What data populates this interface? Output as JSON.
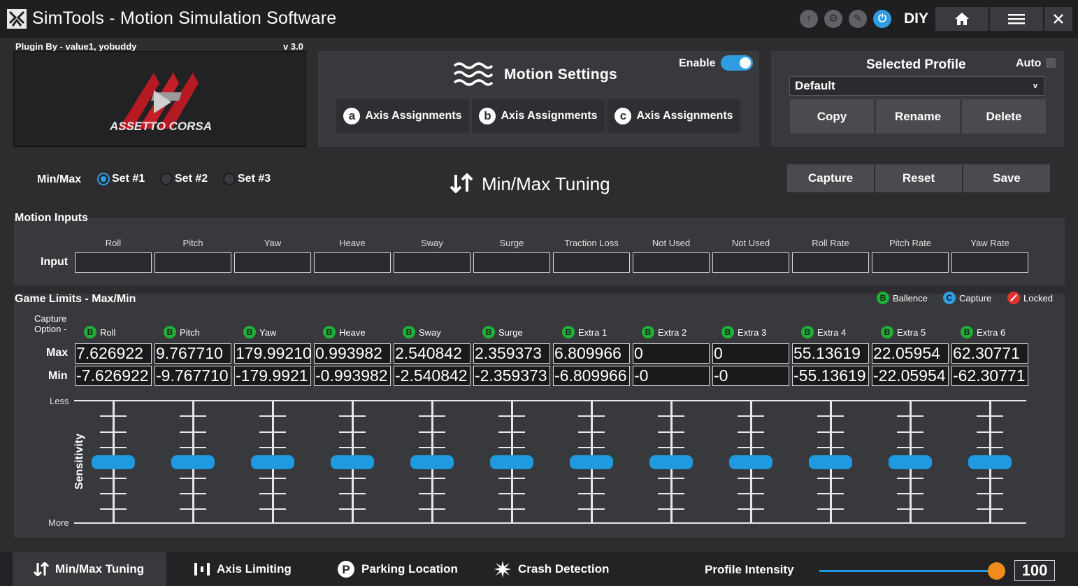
{
  "app": {
    "title": "SimTools - Motion Simulation Software",
    "diy_label": "DIY",
    "accent_color": "#2f9de2"
  },
  "titlebar_icons": [
    "arrow-up-icon",
    "gear-icon",
    "edit-icon",
    "power-icon",
    "home-icon",
    "menu-icon",
    "close-icon"
  ],
  "plugin": {
    "label": "Plugin By - value1, yobuddy",
    "version": "v 3.0",
    "game_logo_text": "ASSETTO CORSA"
  },
  "motion_settings": {
    "title": "Motion Settings",
    "enable_label": "Enable",
    "enabled": true,
    "axis_buttons": [
      {
        "badge": "a",
        "label": "Axis Assignments"
      },
      {
        "badge": "b",
        "label": "Axis Assignments"
      },
      {
        "badge": "c",
        "label": "Axis Assignments"
      }
    ]
  },
  "profile": {
    "title": "Selected Profile",
    "auto_label": "Auto",
    "auto_checked": false,
    "selected": "Default",
    "dropdown_chevron": "v",
    "copy_label": "Copy",
    "rename_label": "Rename",
    "delete_label": "Delete"
  },
  "tuning": {
    "minmax_label": "Min/Max",
    "sets": [
      "Set #1",
      "Set #2",
      "Set #3"
    ],
    "selected_set": 0,
    "title": "Min/Max Tuning",
    "capture_label": "Capture",
    "reset_label": "Reset",
    "save_label": "Save"
  },
  "motion_inputs": {
    "title": "Motion Inputs",
    "row_label": "Input",
    "columns": [
      "Roll",
      "Pitch",
      "Yaw",
      "Heave",
      "Sway",
      "Surge",
      "Traction Loss",
      "Not Used",
      "Not Used",
      "Roll Rate",
      "Pitch Rate",
      "Yaw Rate"
    ],
    "values": [
      "",
      "",
      "",
      "",
      "",
      "",
      "",
      "",
      "",
      "",
      "",
      ""
    ]
  },
  "game_limits": {
    "title": "Game Limits - Max/Min",
    "legend": [
      {
        "badge": "B",
        "label": "Ballence",
        "color": "#1fb037"
      },
      {
        "badge": "C",
        "label": "Capture",
        "color": "#2f9de2"
      },
      {
        "badge": "",
        "label": "Locked",
        "color": "#e23333"
      }
    ],
    "capture_option_label": "Capture Option -",
    "max_label": "Max",
    "min_label": "Min",
    "columns": [
      "Roll",
      "Pitch",
      "Yaw",
      "Heave",
      "Sway",
      "Surge",
      "Extra 1",
      "Extra 2",
      "Extra 3",
      "Extra 4",
      "Extra 5",
      "Extra 6"
    ],
    "column_badge": "B",
    "max_values": [
      "7.626922",
      "9.767710",
      "179.99210",
      "0.993982",
      "2.540842",
      "2.359373",
      "6.809966",
      "0",
      "0",
      "55.13619",
      "22.05954",
      "62.30771"
    ],
    "min_values": [
      "-7.626922",
      "-9.767710",
      "-179.9921",
      "-0.993982",
      "-2.540842",
      "-2.359373",
      "-6.809966",
      "-0",
      "-0",
      "-55.13619",
      "-22.05954",
      "-62.30771"
    ]
  },
  "sensitivity": {
    "label": "Sensitivity",
    "less_label": "Less",
    "more_label": "More",
    "levels": [
      0.5,
      0.5,
      0.5,
      0.5,
      0.5,
      0.5,
      0.5,
      0.5,
      0.5,
      0.5,
      0.5,
      0.5
    ]
  },
  "bottom_nav": {
    "items": [
      {
        "label": "Min/Max Tuning",
        "icon": "updown-arrows-icon",
        "active": true
      },
      {
        "label": "Axis Limiting",
        "icon": "bars-icon",
        "active": false
      },
      {
        "label": "Parking Location",
        "icon": "parking-icon",
        "active": false
      },
      {
        "label": "Crash Detection",
        "icon": "burst-icon",
        "active": false
      }
    ],
    "intensity_label": "Profile Intensity",
    "intensity_value": "100",
    "intensity_fraction": 1.0
  }
}
